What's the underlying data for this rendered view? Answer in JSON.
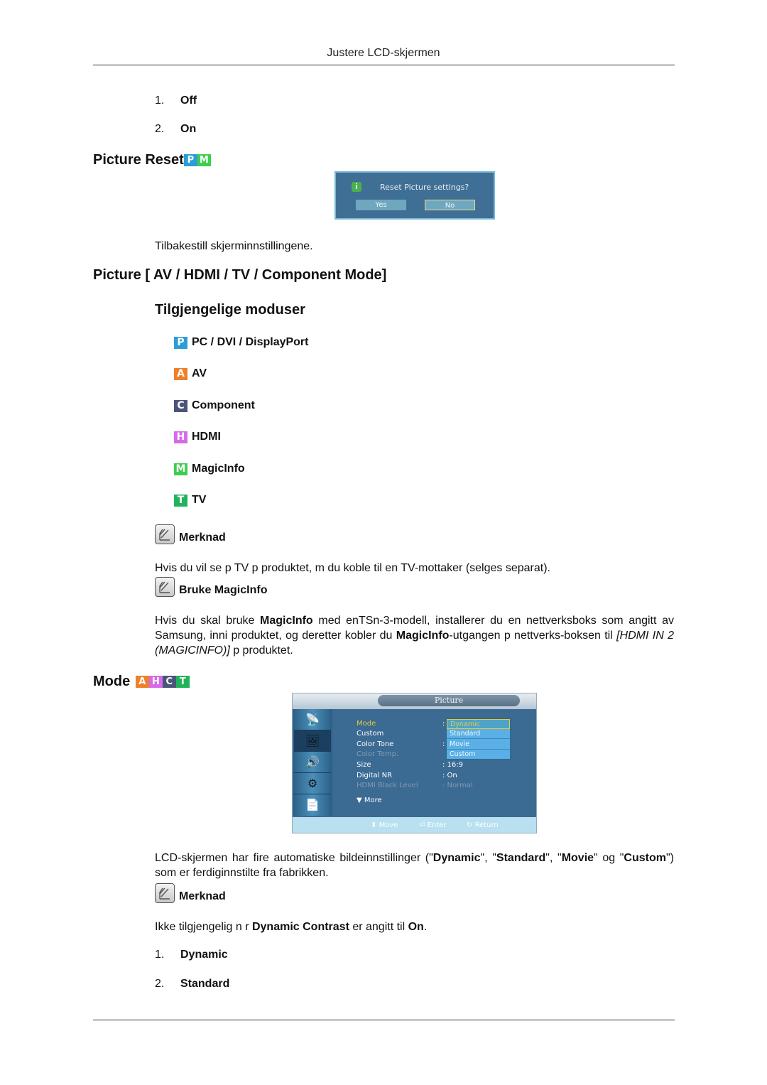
{
  "header": {
    "title": "Justere LCD-skjermen"
  },
  "list_top": [
    {
      "num": "1.",
      "label": "Off"
    },
    {
      "num": "2.",
      "label": "On"
    }
  ],
  "picture_reset": {
    "heading": "Picture Reset",
    "badges": [
      {
        "letter": "P",
        "color": "#2a9fd6"
      },
      {
        "letter": "M",
        "color": "#3ccf4e"
      }
    ],
    "dialog": {
      "icon": "i",
      "question": "Reset Picture settings?",
      "yes_label": "Yes",
      "no_label": "No"
    },
    "description": "Tilbakestill skjerminnstillingene."
  },
  "picture_mode": {
    "heading": "Picture [ AV / HDMI / TV / Component Mode]",
    "subheading": "Tilgjengelige moduser",
    "modes": [
      {
        "letter": "P",
        "color": "#2a9fd6",
        "label": "PC / DVI / DisplayPort"
      },
      {
        "letter": "A",
        "color": "#f07f2a",
        "label": "AV"
      },
      {
        "letter": "C",
        "color": "#4a5577",
        "label": "Component"
      },
      {
        "letter": "H",
        "color": "#d56be8",
        "label": "HDMI"
      },
      {
        "letter": "M",
        "color": "#3ccf4e",
        "label": "MagicInfo"
      },
      {
        "letter": "T",
        "color": "#22b35a",
        "label": "TV"
      }
    ],
    "note1": {
      "title": "Merknad",
      "text": "Hvis du vil se p  TV p  produktet, m  du koble til en TV-mottaker (selges separat)."
    },
    "note2": {
      "title": "Bruke MagicInfo",
      "text_a": "Hvis du skal bruke ",
      "bold_a": "MagicInfo",
      "text_b": " med enTSn-3-modell, installerer du en nettverksboks som angitt av Samsung, inni produktet, og deretter kobler du ",
      "bold_b": "MagicInfo",
      "text_c": "-utgangen p  nettverks-boksen til ",
      "italic": "[HDMI IN 2 (MAGICINFO)]",
      "text_d": " p  produktet."
    }
  },
  "mode_section": {
    "heading": "Mode",
    "badges": [
      {
        "letter": "A",
        "color": "#f07f2a"
      },
      {
        "letter": "H",
        "color": "#d56be8"
      },
      {
        "letter": "C",
        "color": "#4a5577"
      },
      {
        "letter": "T",
        "color": "#22b35a"
      }
    ],
    "tv_menu": {
      "title": "Picture",
      "rows": [
        {
          "label": "Mode",
          "value": ":",
          "state": "active"
        },
        {
          "label": "Custom",
          "value": "",
          "state": "normal"
        },
        {
          "label": "Color Tone",
          "value": ":",
          "state": "normal"
        },
        {
          "label": "Color Temp.",
          "value": "",
          "state": "disabled"
        },
        {
          "label": "Size",
          "value": ": 16:9",
          "state": "normal"
        },
        {
          "label": "Digital NR",
          "value": ": On",
          "state": "normal"
        },
        {
          "label": "HDMI Black Level",
          "value": ": Normal",
          "state": "disabled"
        }
      ],
      "more_label": "▼ More",
      "dropdown": [
        "Dynamic",
        "Standard",
        "Movie",
        "Custom"
      ],
      "dropdown_selected": "Dynamic",
      "bottom": {
        "move": "Move",
        "enter": "Enter",
        "return": "Return"
      }
    },
    "para_a": "LCD-skjermen har fire automatiske bildeinnstillinger (\"",
    "b1": "Dynamic",
    "sep1": "\", \"",
    "b2": "Standard",
    "sep2": "\", \"",
    "b3": "Movie",
    "sep3": "\" og \"",
    "b4": "Custom",
    "para_end": "\") som er ferdiginnstilte fra fabrikken.",
    "note": {
      "title": "Merknad",
      "text_a": "Ikke tilgjengelig n r  ",
      "bold_a": "Dynamic Contrast",
      "text_b": " er angitt til ",
      "bold_b": "On",
      "text_c": "."
    },
    "list": [
      {
        "num": "1.",
        "label": "Dynamic"
      },
      {
        "num": "2.",
        "label": "Standard"
      }
    ]
  }
}
